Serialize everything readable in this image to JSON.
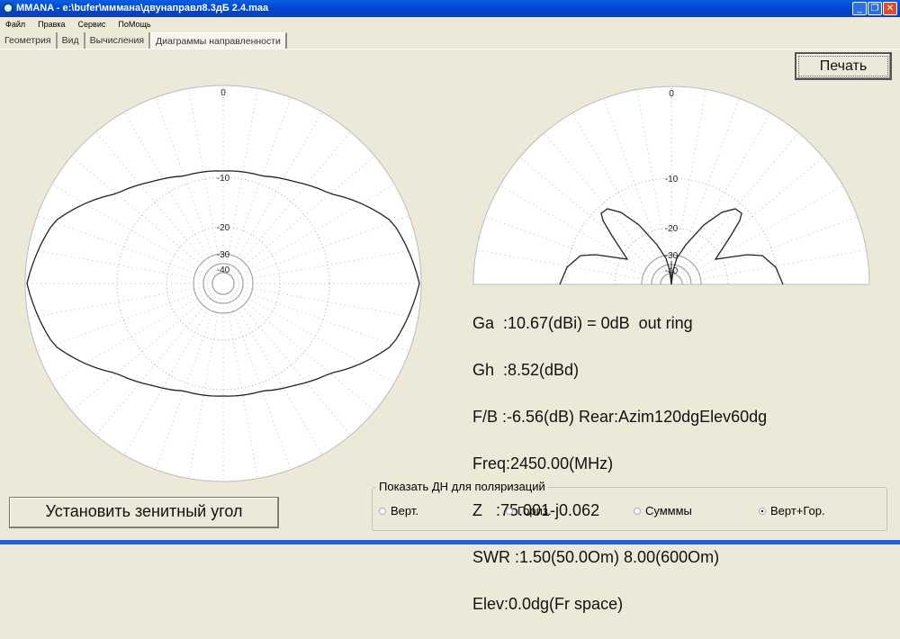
{
  "window": {
    "title": "MMANA - e:\\bufer\\мммана\\двунаправл8.3дБ 2.4.maa",
    "min": "_",
    "restore": "❐",
    "close": "✕"
  },
  "menu": [
    "Файл",
    "Правка",
    "Сервис",
    "ПоМощь"
  ],
  "tabs": [
    "Геометрия",
    "Вид",
    "Вычисления",
    "Диаграммы направленности"
  ],
  "print_label": "Печать",
  "zenith_label": "Установить зенитный угол",
  "plot_labels": [
    "0",
    "-10",
    "-20",
    "-30",
    "-40"
  ],
  "info": [
    "Ga  :10.67(dBi) = 0dB  out ring",
    "Gh  :8.52(dBd)",
    "F/B :-6.56(dB) Rear:Azim120dgElev60dg",
    "Freq:2450.00(MHz)",
    "Z   :75.001-j0.062",
    "SWR :1.50(50.0Om) 8.00(600Om)",
    "Elev:0.0dg(Fr space)"
  ],
  "polarization": {
    "title": "Показать ДН для поляризаций",
    "options": [
      "Верт.",
      "Гориз.",
      "Сумммы",
      "Верт+Гор."
    ],
    "selected": 3
  }
}
